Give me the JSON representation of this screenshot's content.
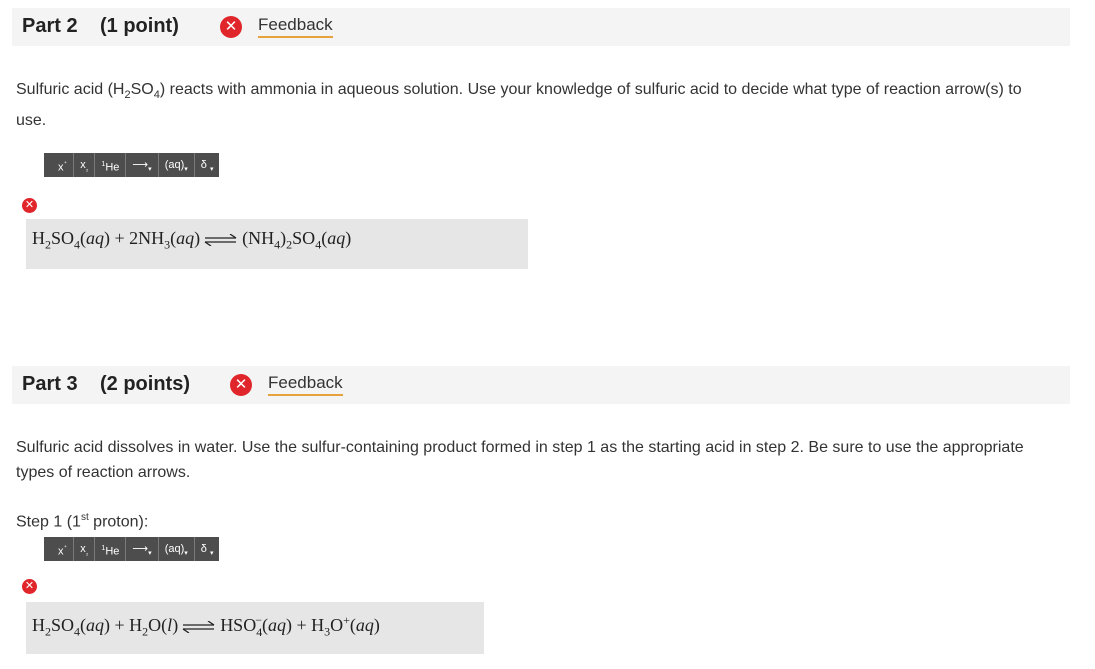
{
  "part2": {
    "title": "Part 2",
    "points": "(1 point)",
    "feedback": "Feedback",
    "prompt": "Sulfuric acid (H₂SO₄) reacts with ammonia in aqueous solution. Use your knowledge of sulfuric acid to decide what type of reaction arrow(s) to use."
  },
  "part3": {
    "title": "Part 3",
    "points": "(2 points)",
    "feedback": "Feedback",
    "prompt": "Sulfuric acid dissolves in water. Use the sulfur-containing product formed in step 1 as the starting acid in step 2.  Be sure to use the appropriate types of reaction arrows.",
    "step_label": "Step 1 (1st proton):"
  },
  "toolbar": {
    "superscript": "x",
    "subscript": "x",
    "element": "He",
    "arrow": "→",
    "state": "(aq)",
    "delta": "δ"
  },
  "icons": {
    "error": "error-x-icon"
  },
  "colors": {
    "error": "#e0262b",
    "feedback_underline": "#e6a23c",
    "toolbar": "#4d4d4d",
    "answer_bg": "#e6e6e6"
  }
}
